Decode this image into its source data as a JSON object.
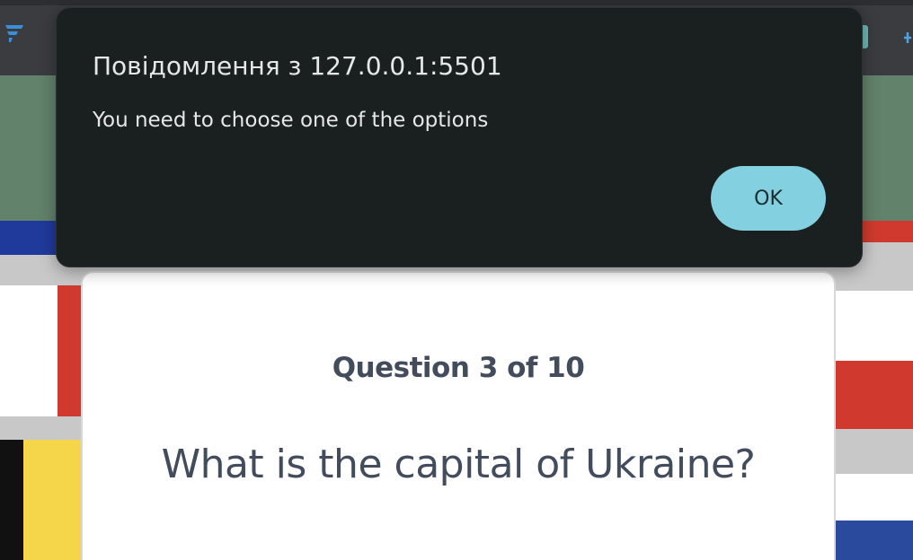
{
  "alert": {
    "title": "Повідомлення з 127.0.0.1:5501",
    "message": "You need to choose one of the options",
    "ok_label": "OK"
  },
  "quiz": {
    "counter": "Question 3 of 10",
    "question": "What is the capital of Ukraine?"
  },
  "colors": {
    "dialog_bg": "#1a1f20",
    "ok_button": "#83d0e1",
    "header_band": "#62826b",
    "text": "#434c5c"
  },
  "icons": {
    "browser_left": "extension-logo-icon",
    "browser_right": "extension-icon",
    "browser_far_right": "toolbar-icon"
  }
}
